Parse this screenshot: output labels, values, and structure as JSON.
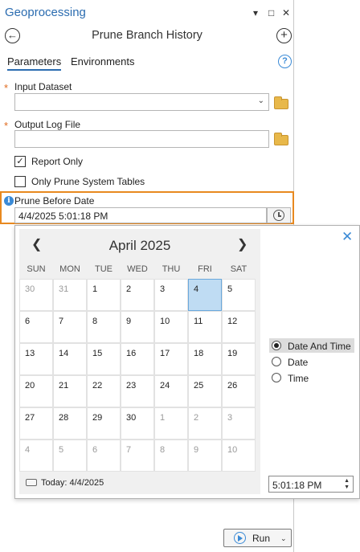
{
  "pane": {
    "title": "Geoprocessing",
    "window_controls": {
      "dropdown": "▾",
      "maximize": "□",
      "close": "✕"
    }
  },
  "tool": {
    "back_icon": "back-arrow-icon",
    "title": "Prune Branch History",
    "add_icon": "add-icon"
  },
  "tabs": [
    {
      "label": "Parameters",
      "active": true
    },
    {
      "label": "Environments",
      "active": false
    }
  ],
  "params": {
    "required_marker": "*",
    "input_dataset": {
      "label": "Input Dataset",
      "value": "",
      "required": true
    },
    "output_log": {
      "label": "Output Log File",
      "value": "",
      "required": true
    },
    "report_only": {
      "label": "Report Only",
      "checked": true
    },
    "prune_system": {
      "label": "Only Prune System Tables",
      "checked": false
    },
    "prune_before": {
      "label": "Prune Before Date",
      "value": "4/4/2025 5:01:18 PM"
    }
  },
  "calendar": {
    "month_label": "April 2025",
    "prev": "❮",
    "next": "❯",
    "weekdays": [
      "SUN",
      "MON",
      "TUE",
      "WED",
      "THU",
      "FRI",
      "SAT"
    ],
    "weeks": [
      [
        "30",
        "31",
        "1",
        "2",
        "3",
        "4",
        "5"
      ],
      [
        "6",
        "7",
        "8",
        "9",
        "10",
        "11",
        "12"
      ],
      [
        "13",
        "14",
        "15",
        "16",
        "17",
        "18",
        "19"
      ],
      [
        "20",
        "21",
        "22",
        "23",
        "24",
        "25",
        "26"
      ],
      [
        "27",
        "28",
        "29",
        "30",
        "1",
        "2",
        "3"
      ],
      [
        "4",
        "5",
        "6",
        "7",
        "8",
        "9",
        "10"
      ]
    ],
    "selected_day": "4",
    "today_label": "Today: 4/4/2025",
    "close": "✕"
  },
  "modes": [
    {
      "label": "Date And Time",
      "selected": true
    },
    {
      "label": "Date",
      "selected": false
    },
    {
      "label": "Time",
      "selected": false
    }
  ],
  "time_value": "5:01:18 PM",
  "run_label": "Run",
  "colors": {
    "accent": "#2b6cb0",
    "highlight_border": "#e8891f",
    "selected_day": "#bfdcf3",
    "required": "#e06b1f"
  }
}
